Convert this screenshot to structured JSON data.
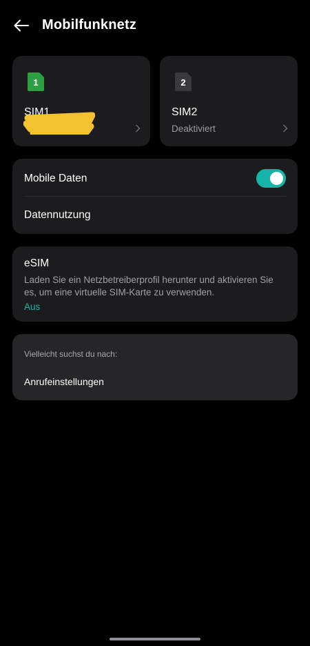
{
  "header": {
    "title": "Mobilfunknetz",
    "back_icon": "arrow-left-icon"
  },
  "sims": [
    {
      "number": "1",
      "label": "SIM1",
      "status": "",
      "color": "#2ea043",
      "redacted": true
    },
    {
      "number": "2",
      "label": "SIM2",
      "status": "Deaktiviert",
      "color": "#3a3a3c"
    }
  ],
  "data": {
    "mobile_data_label": "Mobile Daten",
    "mobile_data_enabled": true,
    "usage_label": "Datennutzung"
  },
  "esim": {
    "title": "eSIM",
    "description": "Laden Sie ein Netzbetreiberprofil herunter und aktivieren Sie es, um eine virtuelle SIM-Karte zu verwenden.",
    "status": "Aus"
  },
  "suggestions": {
    "heading": "Vielleicht suchst du nach:",
    "items": [
      "Anrufeinstellungen"
    ]
  },
  "colors": {
    "accent": "#17b3a8",
    "background": "#000000",
    "card": "#1c1c1e"
  }
}
